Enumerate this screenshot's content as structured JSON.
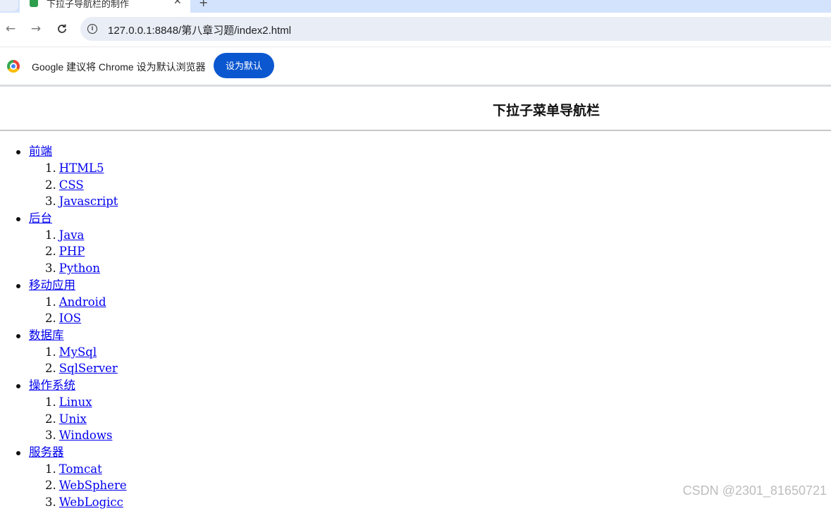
{
  "browser": {
    "tab_title": "下拉子导航栏的制作",
    "tab_close": "✕",
    "new_tab": "+",
    "back": "←",
    "forward": "→",
    "reload": "C",
    "url": "127.0.0.1:8848/第八章习题/index2.html",
    "info_icon": "i"
  },
  "infobar": {
    "message": "Google 建议将 Chrome 设为默认浏览器",
    "button_label": "设为默认"
  },
  "page": {
    "title": "下拉子菜单导航栏",
    "menu": [
      {
        "label": "前端",
        "items": [
          "HTML5",
          "CSS",
          "Javascript"
        ]
      },
      {
        "label": "后台",
        "items": [
          "Java",
          "PHP",
          "Python"
        ]
      },
      {
        "label": "移动应用",
        "items": [
          "Android",
          "IOS"
        ]
      },
      {
        "label": "数据库",
        "items": [
          "MySql",
          "SqlServer"
        ]
      },
      {
        "label": "操作系统",
        "items": [
          "Linux",
          "Unix",
          "Windows"
        ]
      },
      {
        "label": "服务器",
        "items": [
          "Tomcat",
          "WebSphere",
          "WebLogicc"
        ]
      }
    ],
    "numbers": [
      "1.",
      "2.",
      "3."
    ]
  },
  "watermark": "CSDN @2301_81650721",
  "colors": {
    "link": "#0000ee",
    "infobar_button": "#0b57d0",
    "tabstrip": "#d3e3fd"
  }
}
